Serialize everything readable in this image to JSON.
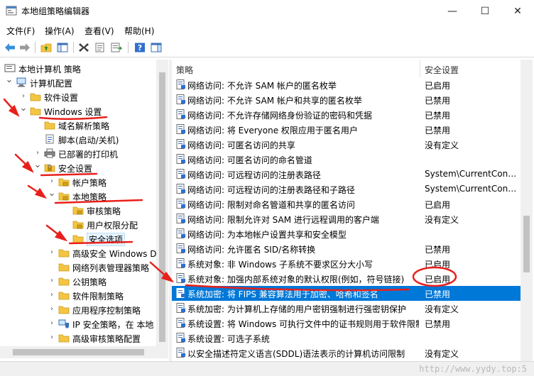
{
  "window": {
    "title": "本地组策略编辑器",
    "buttons": {
      "minimize": "—",
      "maximize": "☐",
      "close": "✕"
    }
  },
  "menu": {
    "items": [
      {
        "label": "文件(F)"
      },
      {
        "label": "操作(A)"
      },
      {
        "label": "查看(V)"
      },
      {
        "label": "帮助(H)"
      }
    ]
  },
  "toolbar": {
    "buttons": [
      {
        "icon": "back-arrow-icon"
      },
      {
        "icon": "forward-arrow-icon"
      },
      {
        "icon": "up-folder-icon"
      },
      {
        "icon": "show-hide-tree-icon"
      },
      {
        "icon": "delete-icon"
      },
      {
        "icon": "properties-icon"
      },
      {
        "icon": "export-list-icon"
      },
      {
        "icon": "help-icon"
      },
      {
        "icon": "show-hide-action-pane-icon"
      }
    ]
  },
  "tree": {
    "items": [
      {
        "label": "本地计算机 策略",
        "level": 0,
        "expanded": "",
        "icon": "computer-policy-icon"
      },
      {
        "label": "计算机配置",
        "level": 1,
        "expanded": "open",
        "icon": "computer-icon"
      },
      {
        "label": "软件设置",
        "level": 2,
        "expanded": "closed",
        "icon": "folder-icon"
      },
      {
        "label": "Windows 设置",
        "level": 2,
        "expanded": "open",
        "icon": "folder-icon"
      },
      {
        "label": "域名解析策略",
        "level": 3,
        "expanded": "",
        "icon": "folder-icon"
      },
      {
        "label": "脚本(启动/关机)",
        "level": 3,
        "expanded": "",
        "icon": "script-icon"
      },
      {
        "label": "已部署的打印机",
        "level": 3,
        "expanded": "closed",
        "icon": "printer-icon"
      },
      {
        "label": "安全设置",
        "level": 3,
        "expanded": "open",
        "icon": "security-settings-icon"
      },
      {
        "label": "帐户策略",
        "level": 4,
        "expanded": "closed",
        "icon": "policy-folder-icon"
      },
      {
        "label": "本地策略",
        "level": 4,
        "expanded": "open",
        "icon": "policy-folder-icon"
      },
      {
        "label": "审核策略",
        "level": 5,
        "expanded": "",
        "icon": "policy-folder-icon"
      },
      {
        "label": "用户权限分配",
        "level": 5,
        "expanded": "",
        "icon": "policy-folder-icon"
      },
      {
        "label": "安全选项",
        "level": 5,
        "expanded": "",
        "icon": "folder-icon",
        "selected": true
      },
      {
        "label": "高级安全 Windows D",
        "level": 4,
        "expanded": "closed",
        "icon": "folder-icon"
      },
      {
        "label": "网络列表管理器策略",
        "level": 4,
        "expanded": "",
        "icon": "folder-icon"
      },
      {
        "label": "公钥策略",
        "level": 4,
        "expanded": "closed",
        "icon": "folder-icon"
      },
      {
        "label": "软件限制策略",
        "level": 4,
        "expanded": "closed",
        "icon": "folder-icon"
      },
      {
        "label": "应用程序控制策略",
        "level": 4,
        "expanded": "closed",
        "icon": "folder-icon"
      },
      {
        "label": "IP 安全策略，在 本地",
        "level": 4,
        "expanded": "closed",
        "icon": "ip-security-icon"
      },
      {
        "label": "高级审核策略配置",
        "level": 4,
        "expanded": "closed",
        "icon": "folder-icon"
      }
    ]
  },
  "list": {
    "columns": {
      "policy": "策略",
      "setting": "安全设置"
    },
    "rows": [
      {
        "policy": "网络访问: 不允许 SAM 帐户的匿名枚举",
        "setting": "已启用"
      },
      {
        "policy": "网络访问: 不允许 SAM 帐户和共享的匿名枚举",
        "setting": "已禁用"
      },
      {
        "policy": "网络访问: 不允许存储网络身份验证的密码和凭据",
        "setting": "已禁用"
      },
      {
        "policy": "网络访问: 将 Everyone 权限应用于匿名用户",
        "setting": "已禁用"
      },
      {
        "policy": "网络访问: 可匿名访问的共享",
        "setting": "没有定义"
      },
      {
        "policy": "网络访问: 可匿名访问的命名管道",
        "setting": ""
      },
      {
        "policy": "网络访问: 可远程访问的注册表路径",
        "setting": "System\\CurrentControlSet\\Control\\Product"
      },
      {
        "policy": "网络访问: 可远程访问的注册表路径和子路径",
        "setting": "System\\CurrentControlSet\\Control\\Print"
      },
      {
        "policy": "网络访问: 限制对命名管道和共享的匿名访问",
        "setting": "已启用"
      },
      {
        "policy": "网络访问: 限制允许对 SAM 进行远程调用的客户端",
        "setting": "没有定义"
      },
      {
        "policy": "网络访问: 为本地帐户设置共享和安全模型",
        "setting": ""
      },
      {
        "policy": "网络访问: 允许匿名 SID/名称转换",
        "setting": "已禁用"
      },
      {
        "policy": "系统对象: 非 Windows 子系统不要求区分大小写",
        "setting": "已启用"
      },
      {
        "policy": "系统对象: 加强内部系统对象的默认权限(例如，符号链接)",
        "setting": "已启用"
      },
      {
        "policy": "系统加密: 将 FIPS 兼容算法用于加密、哈希和签名",
        "setting": "已禁用",
        "selected": true
      },
      {
        "policy": "系统加密: 为计算机上存储的用户密钥强制进行强密钥保护",
        "setting": "没有定义"
      },
      {
        "policy": "系统设置: 将 Windows 可执行文件中的证书规则用于软件限制策略",
        "setting": "已禁用"
      },
      {
        "policy": "系统设置: 可选子系统",
        "setting": ""
      },
      {
        "policy": "以安全描述符定义语言(SDDL)语法表示的计算机访问限制",
        "setting": "没有定义"
      }
    ]
  },
  "watermark": "http://www.yydy.top:5",
  "colors": {
    "selection": "#0078d7",
    "annotation": "#e8201c",
    "folder": "#f4c542"
  }
}
